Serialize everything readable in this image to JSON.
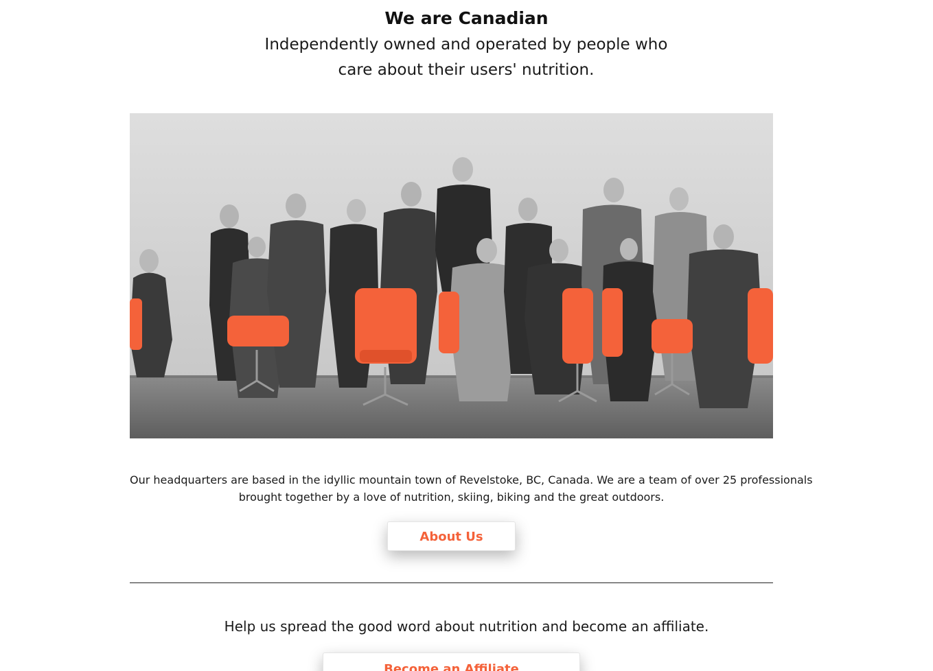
{
  "section": {
    "heading": "We are Canadian",
    "subheading_line1": "Independently owned and operated by people who",
    "subheading_line2": "care about their users' nutrition."
  },
  "team_photo": {
    "description_icon": "team-photo",
    "accent_color": "#f4623a"
  },
  "about": {
    "text_line1": "Our headquarters are based in the idyllic mountain town of Revelstoke, BC, Canada. We are a team of over 25 professionals",
    "text_line2": "brought together by a love of nutrition, skiing, biking and the great outdoors.",
    "button_label": "About Us"
  },
  "affiliate": {
    "text": "Help us spread the good word about nutrition and become an affiliate.",
    "button_label": "Become an Affiliate"
  },
  "colors": {
    "accent": "#f4623a",
    "text": "#1a1a1a",
    "background": "#ffffff"
  }
}
